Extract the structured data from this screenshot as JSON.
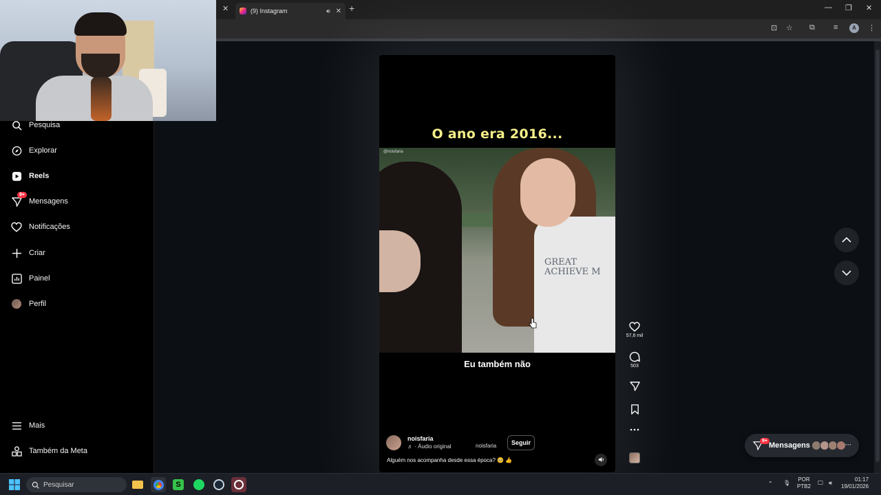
{
  "browser": {
    "tab_title": "(9) Instagram",
    "new_tab": "+",
    "close": "✕",
    "minimize": "—",
    "restore": "❐",
    "close_window": "✕",
    "avatar_letter": "A"
  },
  "sidebar": {
    "items": [
      {
        "label": "Pesquisa",
        "icon": "search-icon"
      },
      {
        "label": "Explorar",
        "icon": "compass-icon"
      },
      {
        "label": "Reels",
        "icon": "reels-icon"
      },
      {
        "label": "Mensagens",
        "icon": "messenger-icon",
        "badge": "9+"
      },
      {
        "label": "Notificações",
        "icon": "heart-icon"
      },
      {
        "label": "Criar",
        "icon": "plus-icon"
      },
      {
        "label": "Painel",
        "icon": "dashboard-icon"
      },
      {
        "label": "Perfil",
        "icon": "avatar"
      }
    ],
    "bottom": [
      {
        "label": "Mais",
        "icon": "menu-icon"
      },
      {
        "label": "Também da Meta",
        "icon": "meta-apps-icon"
      }
    ]
  },
  "reel": {
    "overlay_top": "O ano era 2016...",
    "overlay_bottom": "Eu também não",
    "watermark": "@noisfaria",
    "shirt_text": "GREAT\nACHIEVE M",
    "author": "noisfaria",
    "audio": "♬ · Áudio original",
    "collaborator": "noisfaria",
    "follow_label": "Seguir",
    "caption": "Alguém nos acompanha desde essa época? 🥺 👍"
  },
  "actions": {
    "likes": "57,6 mil",
    "comments": "503"
  },
  "messages_pill": {
    "label": "Mensagens",
    "badge": "9+",
    "more": "···"
  },
  "taskbar": {
    "search_placeholder": "Pesquisar",
    "lang_top": "POR",
    "lang_bottom": "PTB2",
    "time": "01:17",
    "date": "19/01/2026"
  },
  "colors": {
    "accent_red": "#ff3040",
    "overlay_yellow": "#f6ef8a",
    "background": "#0c0f14"
  }
}
